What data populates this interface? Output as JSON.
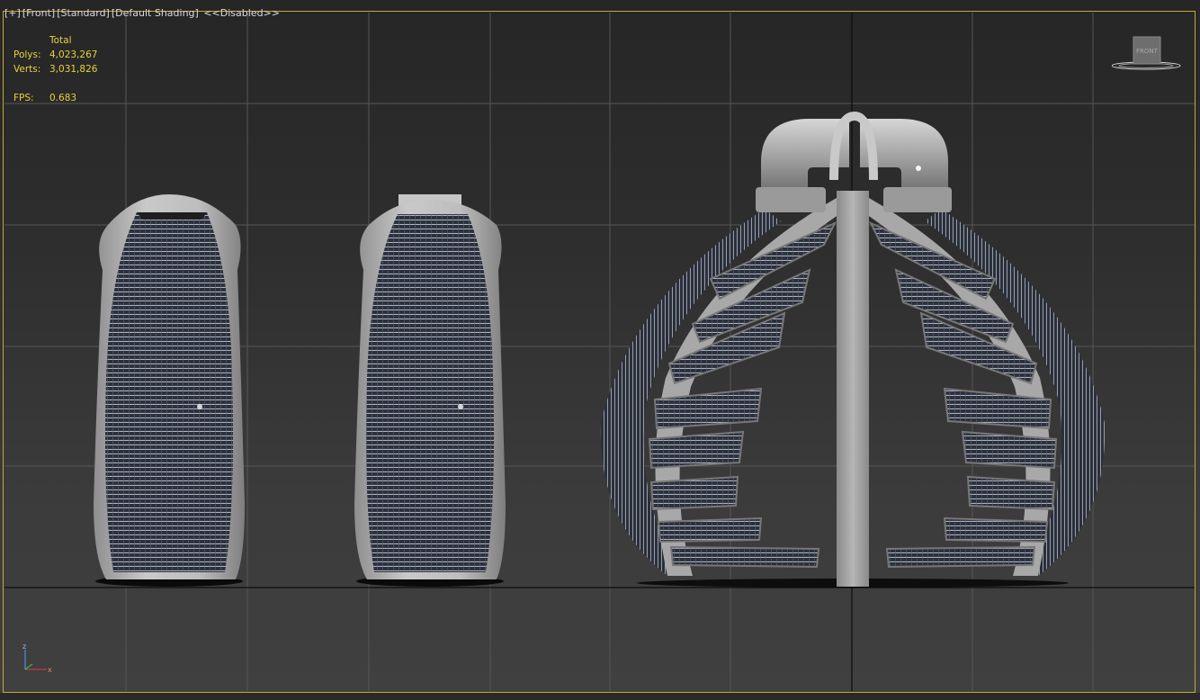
{
  "viewport": {
    "labels": [
      "[+]",
      "[Front]",
      "[Standard]",
      "[Default Shading]",
      "<<Disabled>>"
    ]
  },
  "stats": {
    "header": "Total",
    "polys_label": "Polys:",
    "polys_value": "4,023,267",
    "verts_label": "Verts:",
    "verts_value": "3,031,826",
    "fps_label": "FPS:",
    "fps_value": "0.683"
  },
  "viewcube": {
    "face_label": "FRONT"
  },
  "axis": {
    "z_label": "z",
    "x_label": "x"
  },
  "colors": {
    "frame_border": "#c8a92e",
    "stats_text": "#e8d23a",
    "grid_line": "#5a5a5a",
    "model_shell": "#b9b9b9",
    "panel_mesh": "#2b2f3a"
  }
}
